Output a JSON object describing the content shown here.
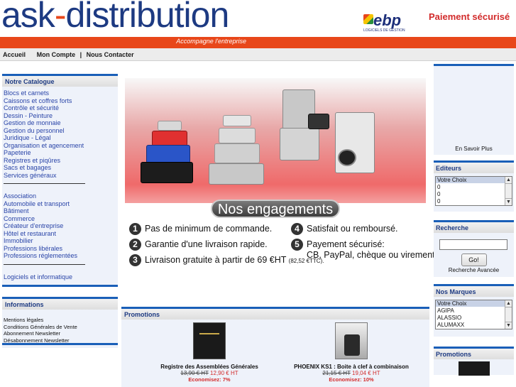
{
  "header": {
    "logo_text_left": "ask",
    "logo_text_dash": "-",
    "logo_text_right": "distribution",
    "tagline": "Accompagne l'entreprise",
    "partner_logo": "ebp",
    "partner_sub": "LOGICIELS DE GESTION",
    "secure_payment": "Paiement sécurisé"
  },
  "nav": {
    "items": [
      "Accueil",
      "Mon Compte",
      "Nous Contacter"
    ],
    "separator": "|"
  },
  "catalog": {
    "title": "Notre Catalogue",
    "group1": [
      "Blocs et carnets",
      "Caissons et coffres forts",
      "Contrôle et sécurité",
      "Dessin - Peinture",
      "Gestion de monnaie",
      "Gestion du personnel",
      "Juridique - Légal",
      "Organisation et agencement",
      "Papeterie",
      "Registres et piqûres",
      "Sacs et bagages",
      "Services généraux"
    ],
    "group2": [
      "Association",
      "Automobile et transport",
      "Bâtiment",
      "Commerce",
      "Créateur d'entreprise",
      "Hôtel et restaurant",
      "Immobilier",
      "Professions libérales",
      "Professions réglementées"
    ],
    "group3": [
      "Logiciels et informatique"
    ]
  },
  "informations": {
    "title": "Informations",
    "items": [
      "Mentions légales",
      "Conditions Générales de Vente",
      "Abonnement Newsletter",
      "Désabonnement Newsletter"
    ]
  },
  "engagements": {
    "banner": "Nos engagements",
    "items": [
      {
        "n": "1",
        "text": "Pas de minimum de commande."
      },
      {
        "n": "2",
        "text": "Garantie d'une livraison rapide."
      },
      {
        "n": "3",
        "text": "Livraison gratuite à partir de 69 €HT",
        "small": "(82,52 €TTC)."
      },
      {
        "n": "4",
        "text": "Satisfait ou remboursé."
      },
      {
        "n": "5",
        "text": "Payement sécurisé:",
        "line2": "CB, PayPal, chèque ou virement."
      }
    ]
  },
  "promotions": {
    "title": "Promotions",
    "products": [
      {
        "name": "Registre des Assemblées Générales",
        "old_price": "13,90 € HT",
        "new_price": "12,90 € HT",
        "savings": "Economisez: 7%"
      },
      {
        "name": "PHOENIX KS1 : Boite à clef à combinaison",
        "old_price": "21,15 € HT",
        "new_price": "19,04 € HT",
        "savings": "Economisez: 10%"
      }
    ]
  },
  "right": {
    "more_link": "En Savoir Plus",
    "editeurs": {
      "title": "Editeurs",
      "options": [
        "Votre Choix",
        "0",
        "0",
        "0"
      ]
    },
    "recherche": {
      "title": "Recherche",
      "button": "Go!",
      "advanced": "Recherche Avancée",
      "input_value": ""
    },
    "marques": {
      "title": "Nos Marques",
      "options": [
        "Votre Choix",
        "AGIPA",
        "ALASSIO",
        "ALUMAXX"
      ]
    },
    "promotions_title": "Promotions"
  },
  "colors": {
    "brand_blue": "#1d3a82",
    "accent_orange": "#e8471a",
    "link_blue": "#2a45a8",
    "price_red": "#d22b2b"
  }
}
